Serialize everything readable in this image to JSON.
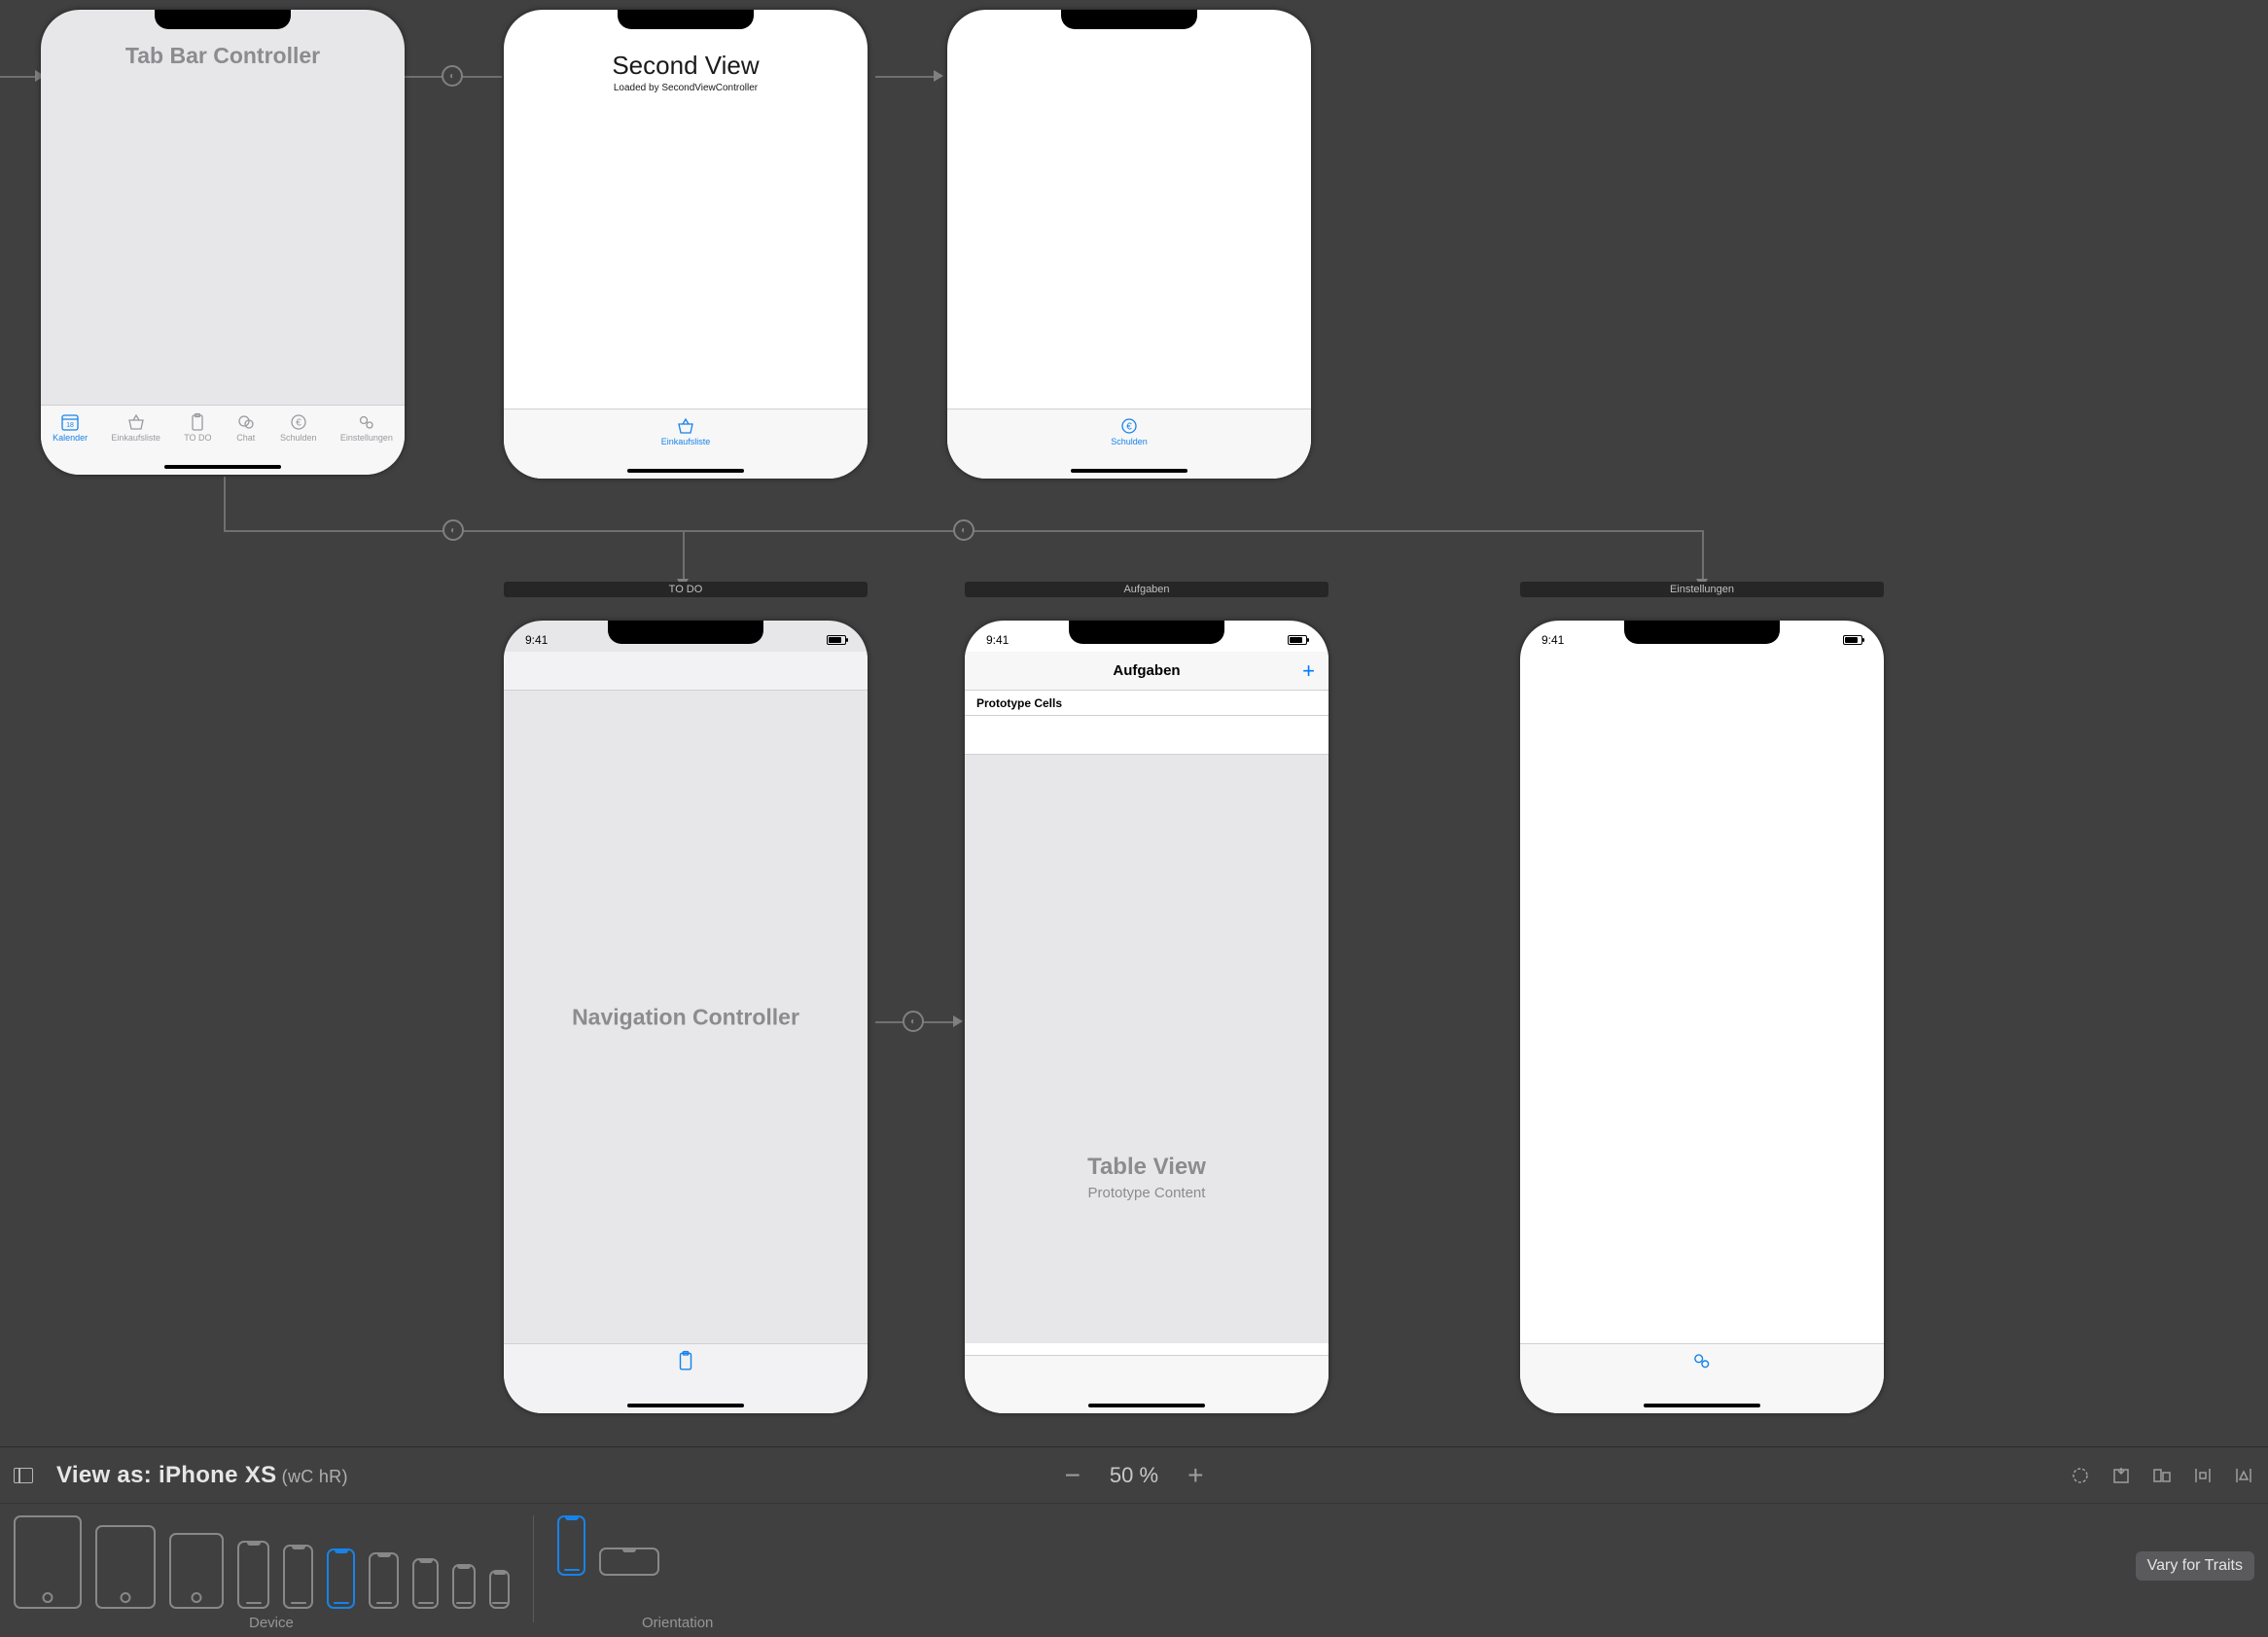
{
  "canvas": {
    "scenes": {
      "tabbarController": {
        "title": "Tab Bar Controller",
        "tabs": [
          {
            "label": "Kalender",
            "icon": "calendar-icon",
            "selected": true
          },
          {
            "label": "Einkaufsliste",
            "icon": "basket-icon"
          },
          {
            "label": "TO DO",
            "icon": "clipboard-icon"
          },
          {
            "label": "Chat",
            "icon": "chat-icon"
          },
          {
            "label": "Schulden",
            "icon": "euro-icon"
          },
          {
            "label": "Einstellungen",
            "icon": "gears-icon"
          }
        ]
      },
      "secondView": {
        "title": "Second View",
        "subtitle": "Loaded by SecondViewController",
        "tabLabel": "Einkaufsliste",
        "tabIcon": "basket-icon"
      },
      "schuldenView": {
        "tabLabel": "Schulden",
        "tabIcon": "euro-icon"
      },
      "navController": {
        "sceneName": "TO DO",
        "title": "Navigation Controller",
        "statusTime": "9:41",
        "tabIcon": "clipboard-icon"
      },
      "aufgaben": {
        "sceneName": "Aufgaben",
        "navTitle": "Aufgaben",
        "addButton": "+",
        "protoHeader": "Prototype Cells",
        "tvTitle": "Table View",
        "tvSubtitle": "Prototype Content",
        "statusTime": "9:41"
      },
      "einstellungen": {
        "sceneName": "Einstellungen",
        "statusTime": "9:41",
        "tabIcon": "gears-icon"
      }
    }
  },
  "bottomBar": {
    "viewAsPrefix": "View as: ",
    "device": "iPhone XS",
    "sizeClass": " (wC hR)",
    "zoomLevel": "50 %",
    "deviceGroupLabel": "Device",
    "orientationGroupLabel": "Orientation",
    "varyForTraits": "Vary for Traits"
  }
}
